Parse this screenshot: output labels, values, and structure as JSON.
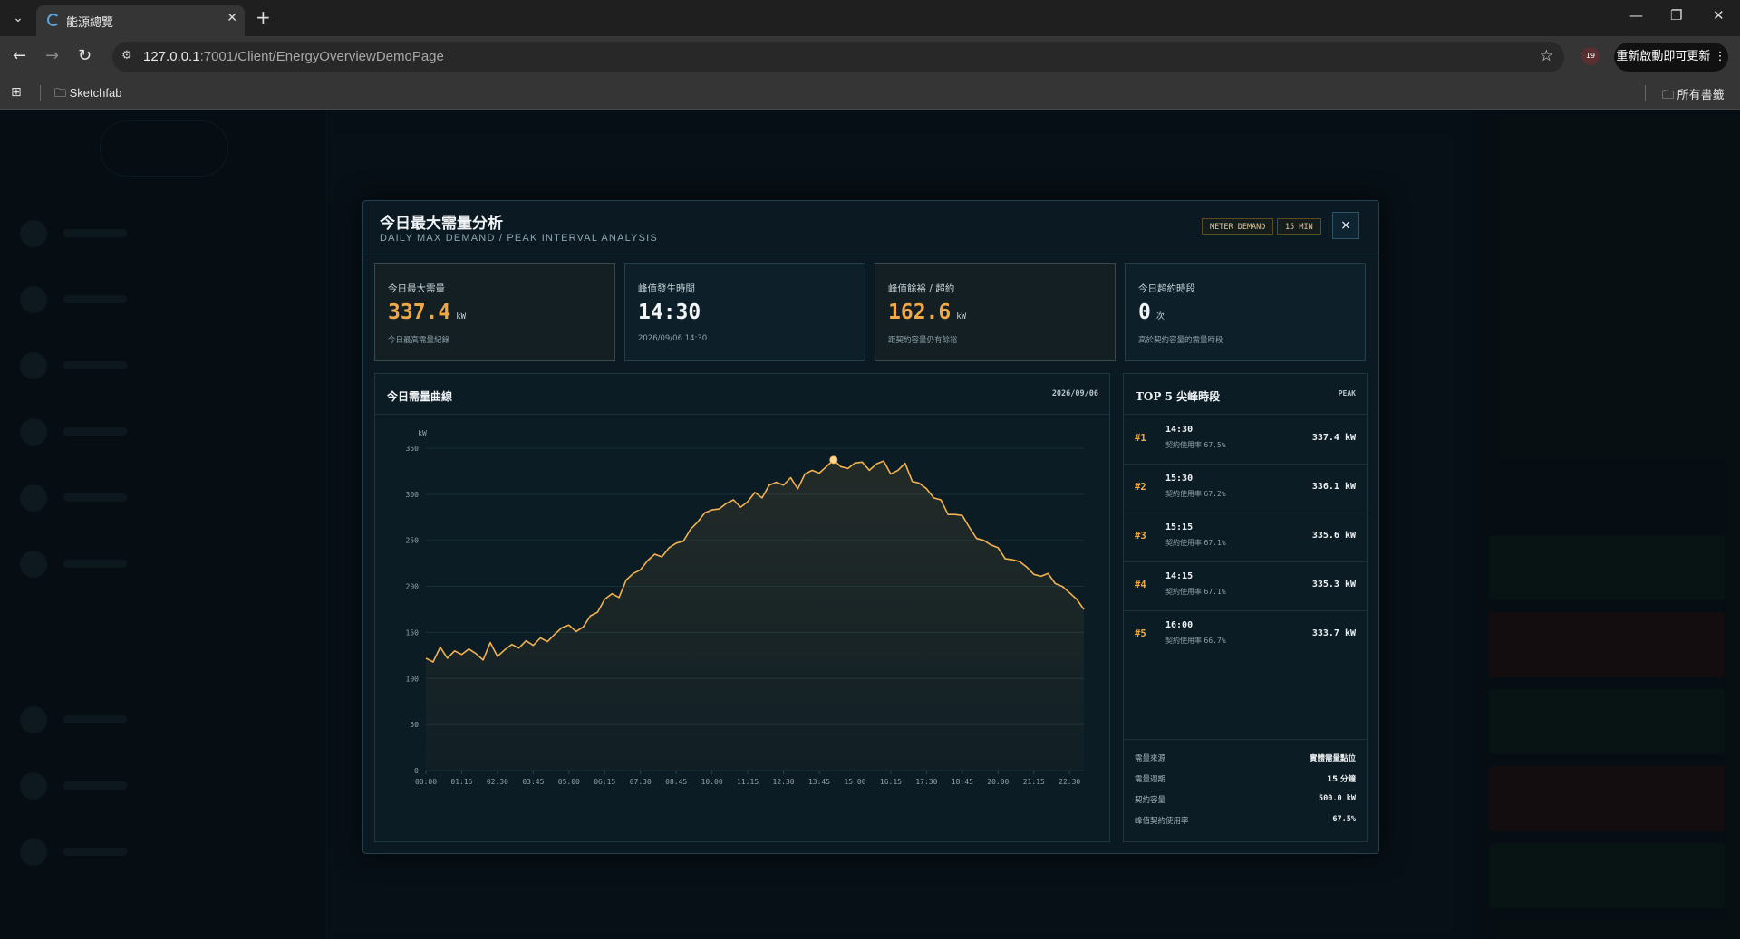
{
  "browser": {
    "tab_title": "能源總覽",
    "url_host": "127.0.0.1",
    "url_rest": ":7001/Client/EnergyOverviewDemoPage",
    "update_button": "重新啟動即可更新",
    "ext_badge": "19",
    "bookmarks": [
      {
        "label": "Sketchfab"
      },
      {
        "label": "所有書籤"
      }
    ],
    "icons": [
      "tab-list-icon",
      "close-icon",
      "plus-icon",
      "minimize-icon",
      "restore-icon",
      "back-icon",
      "forward-icon",
      "reload-icon",
      "site-info-icon",
      "star-icon",
      "apps-icon",
      "folder-icon",
      "more-icon"
    ]
  },
  "modal": {
    "title": "今日最大需量分析",
    "subtitle": "DAILY MAX DEMAND / PEAK INTERVAL ANALYSIS",
    "badges": [
      "METER DEMAND",
      "15 MIN"
    ],
    "close_label": "×",
    "stats": [
      {
        "label": "今日最大需量",
        "value": "337.4",
        "unit": "kW",
        "note": "今日最高需量紀錄",
        "color": "#f0a946"
      },
      {
        "label": "峰值發生時間",
        "value": "14:30",
        "unit": "",
        "note": "2026/09/06 14:30",
        "color": "#f2f5f7"
      },
      {
        "label": "峰值餘裕 / 超約",
        "value": "162.6",
        "unit": "kW",
        "note": "距契約容量仍有餘裕",
        "color": "#f0a946"
      },
      {
        "label": "今日超約時段",
        "value": "0",
        "unit": "次",
        "note": "高於契約容量的需量時段",
        "color": "#f2f5f7"
      }
    ],
    "chart_panel": {
      "title": "今日需量曲線",
      "date": "2026/09/06"
    },
    "top5_panel": {
      "title": "TOP 5 尖峰時段",
      "tag": "PEAK",
      "util_label": "契約使用率",
      "rows": [
        {
          "rank": "#1",
          "time": "14:30",
          "util": "67.5%",
          "value": "337.4 kW"
        },
        {
          "rank": "#2",
          "time": "15:30",
          "util": "67.2%",
          "value": "336.1 kW"
        },
        {
          "rank": "#3",
          "time": "15:15",
          "util": "67.1%",
          "value": "335.6 kW"
        },
        {
          "rank": "#4",
          "time": "14:15",
          "util": "67.1%",
          "value": "335.3 kW"
        },
        {
          "rank": "#5",
          "time": "16:00",
          "util": "66.7%",
          "value": "333.7 kW"
        }
      ],
      "info": [
        {
          "key": "需量來源",
          "value": "實體需量點位",
          "mono": false
        },
        {
          "key": "需量週期",
          "value": "15 分鐘",
          "mono": false
        },
        {
          "key": "契約容量",
          "value": "500.0 kW",
          "mono": true
        },
        {
          "key": "峰值契約使用率",
          "value": "67.5%",
          "mono": true
        }
      ]
    }
  },
  "colors": {
    "accent": "#f0a946",
    "line": "#f2b24e",
    "panel_bg": "#0c1c24",
    "border": "#1d3540"
  },
  "chart_data": {
    "type": "area",
    "title": "今日需量曲線",
    "ylabel": "kW",
    "xlabel": "",
    "ylim": [
      0,
      350
    ],
    "yticks": [
      0,
      50,
      100,
      150,
      200,
      250,
      300,
      350
    ],
    "xtick_labels": [
      "00:00",
      "01:15",
      "02:30",
      "03:45",
      "05:00",
      "06:15",
      "07:30",
      "08:45",
      "10:00",
      "11:15",
      "12:30",
      "13:45",
      "15:00",
      "16:15",
      "17:30",
      "18:45",
      "20:00",
      "21:15",
      "22:30"
    ],
    "grid": true,
    "interval_minutes": 15,
    "start_time": "00:00",
    "peak": {
      "time": "14:30",
      "value": 337.4
    },
    "values": [
      122,
      118,
      134,
      122,
      130,
      126,
      132,
      127,
      120,
      139,
      124,
      131,
      137,
      133,
      141,
      136,
      144,
      140,
      148,
      155,
      158,
      151,
      156,
      168,
      172,
      186,
      192,
      188,
      207,
      214,
      218,
      228,
      235,
      232,
      242,
      247,
      249,
      262,
      270,
      280,
      283,
      284,
      290,
      294,
      286,
      292,
      302,
      296,
      310,
      313,
      310,
      318,
      306,
      322,
      326,
      323,
      330,
      337.4,
      330,
      328,
      334,
      335,
      326,
      333,
      336.1,
      322,
      326,
      333.7,
      314,
      312,
      306,
      296,
      294,
      278,
      278,
      277,
      264,
      252,
      250,
      245,
      242,
      230,
      229,
      227,
      221,
      213,
      211,
      214,
      203,
      200,
      193,
      186,
      175
    ]
  }
}
